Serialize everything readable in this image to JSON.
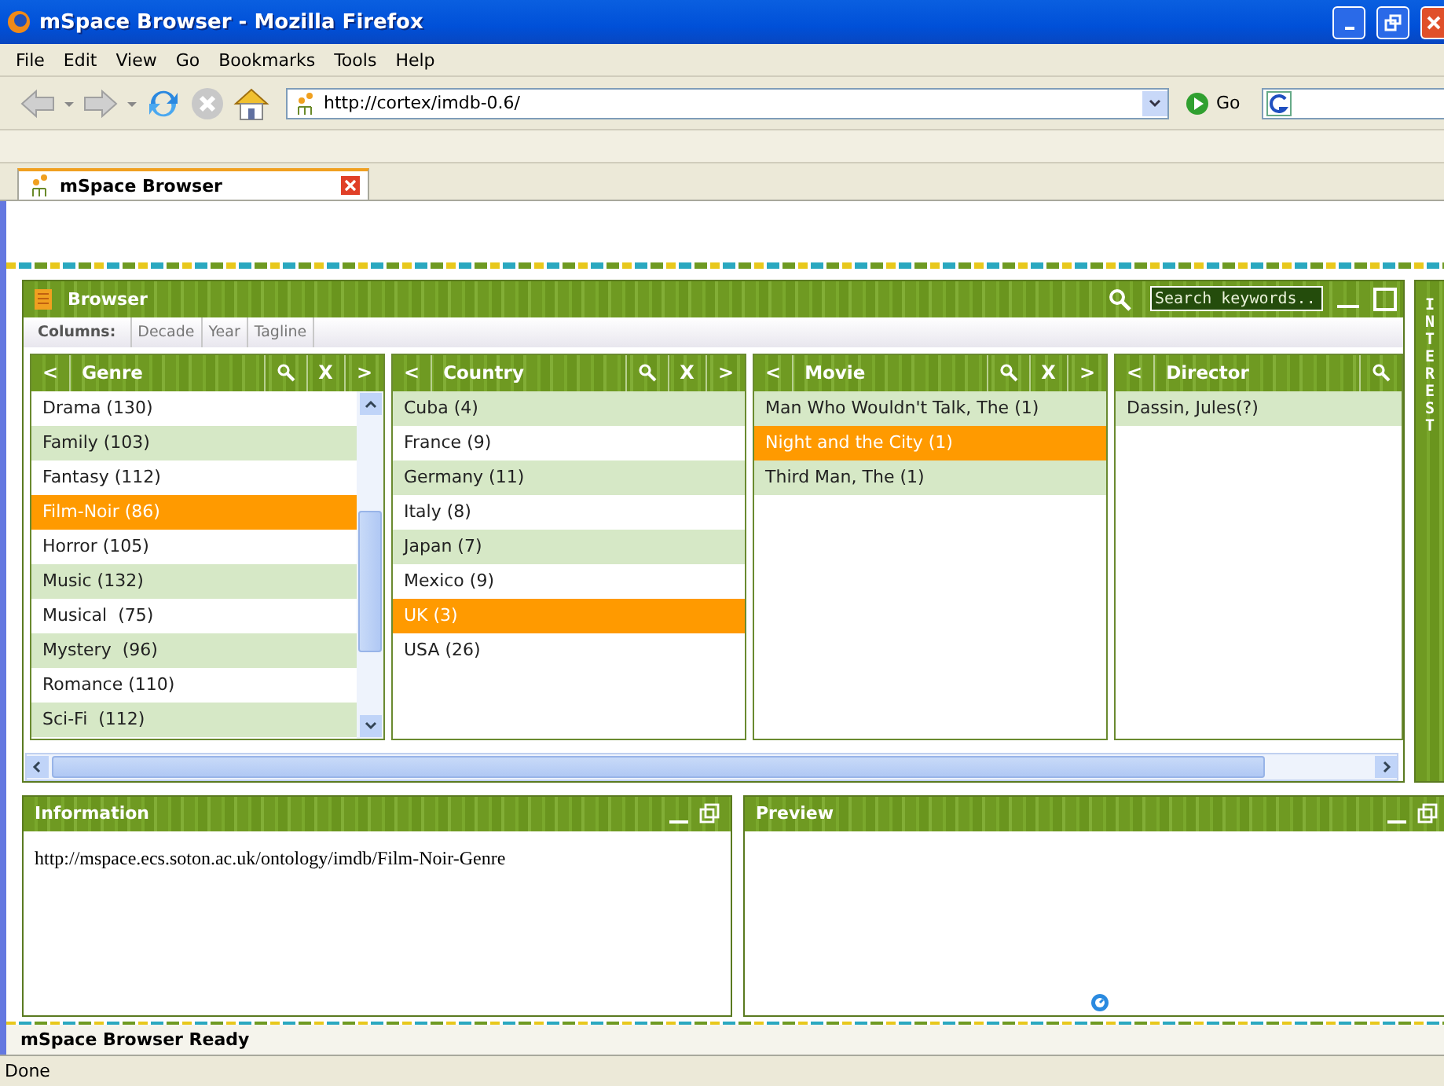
{
  "window": {
    "title": "mSpace Browser - Mozilla Firefox"
  },
  "menu": [
    "File",
    "Edit",
    "View",
    "Go",
    "Bookmarks",
    "Tools",
    "Help"
  ],
  "navigation": {
    "address": "http://cortex/imdb-0.6/",
    "go_label": "Go"
  },
  "tabs": [
    {
      "label": "mSpace Browser",
      "selected": true
    }
  ],
  "browser": {
    "title": "Browser",
    "search": {
      "placeholder": "Search keywords..."
    },
    "columns_label": "Columns:",
    "extra_columns": [
      "Decade",
      "Year",
      "Tagline"
    ],
    "columns": [
      {
        "back": "<",
        "title": "Genre",
        "search": true,
        "remove": "X",
        "forward": ">",
        "scrollbar": true,
        "items": [
          {
            "label": "Drama (130)",
            "highlighted": false,
            "selected": false
          },
          {
            "label": "Family (103)",
            "highlighted": true,
            "selected": false
          },
          {
            "label": "Fantasy (112)",
            "highlighted": false,
            "selected": false
          },
          {
            "label": "Film-Noir (86)",
            "highlighted": false,
            "selected": true
          },
          {
            "label": "Horror (105)",
            "highlighted": false,
            "selected": false
          },
          {
            "label": "Music (132)",
            "highlighted": true,
            "selected": false
          },
          {
            "label": "Musical  (75)",
            "highlighted": false,
            "selected": false
          },
          {
            "label": "Mystery  (96)",
            "highlighted": true,
            "selected": false
          },
          {
            "label": "Romance (110)",
            "highlighted": false,
            "selected": false
          },
          {
            "label": "Sci-Fi  (112)",
            "highlighted": true,
            "selected": false
          }
        ]
      },
      {
        "back": "<",
        "title": "Country",
        "search": true,
        "remove": "X",
        "forward": ">",
        "scrollbar": false,
        "items": [
          {
            "label": "Cuba (4)",
            "highlighted": true,
            "selected": false
          },
          {
            "label": "France (9)",
            "highlighted": false,
            "selected": false
          },
          {
            "label": "Germany (11)",
            "highlighted": true,
            "selected": false
          },
          {
            "label": "Italy (8)",
            "highlighted": false,
            "selected": false
          },
          {
            "label": "Japan (7)",
            "highlighted": true,
            "selected": false
          },
          {
            "label": "Mexico (9)",
            "highlighted": false,
            "selected": false
          },
          {
            "label": "UK (3)",
            "highlighted": false,
            "selected": true
          },
          {
            "label": "USA (26)",
            "highlighted": false,
            "selected": false
          }
        ]
      },
      {
        "back": "<",
        "title": "Movie",
        "search": true,
        "remove": "X",
        "forward": ">",
        "scrollbar": false,
        "items": [
          {
            "label": "Man Who Wouldn't Talk, The (1)",
            "highlighted": true,
            "selected": false
          },
          {
            "label": "Night and the City (1)",
            "highlighted": false,
            "selected": true
          },
          {
            "label": "Third Man, The (1)",
            "highlighted": true,
            "selected": false
          }
        ]
      },
      {
        "back": "<",
        "title": "Director",
        "search": true,
        "scrollbar": false,
        "items": [
          {
            "label": "Dassin, Jules(?)",
            "highlighted": true,
            "selected": false
          }
        ]
      }
    ]
  },
  "side_tab": {
    "label": "INTEREST"
  },
  "information": {
    "title": "Information",
    "text": "http://mspace.ecs.soton.ac.uk/ontology/imdb/Film-Noir-Genre"
  },
  "preview": {
    "title": "Preview"
  },
  "app_status": "mSpace Browser Ready",
  "status_bar": "Done"
}
